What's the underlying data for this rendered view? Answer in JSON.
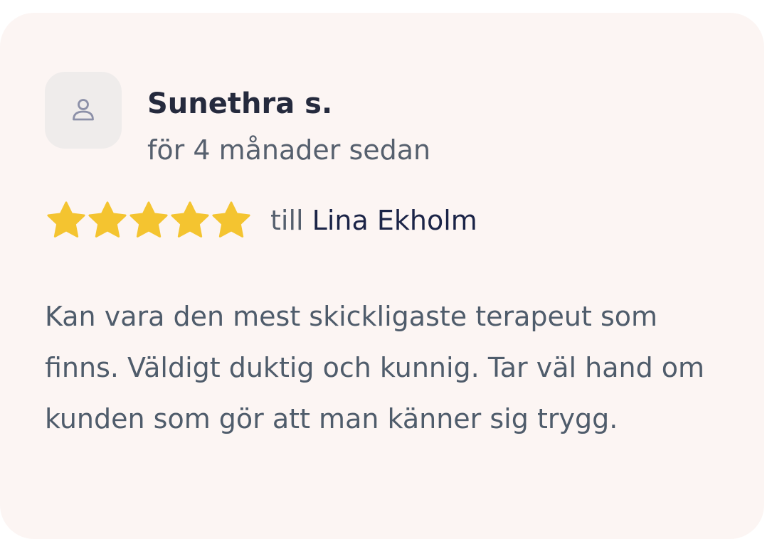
{
  "review": {
    "avatar_icon": "user-icon",
    "reviewer_name": "Sunethra s.",
    "date": "för 4 månader sedan",
    "rating": 5,
    "rating_max": 5,
    "star_color": "#f4c430",
    "target_prefix": "till",
    "therapist_name": "Lina Ekholm",
    "text": "Kan vara den mest skickligaste terapeut som finns. Väldigt duktig och kunnig. Tar väl hand om kunden som gör att man känner sig trygg."
  },
  "colors": {
    "card_background": "#fcf5f3",
    "avatar_background": "#efeceb",
    "name_color": "#252a3d",
    "link_color": "#1b2447",
    "muted_text": "#56606e"
  }
}
